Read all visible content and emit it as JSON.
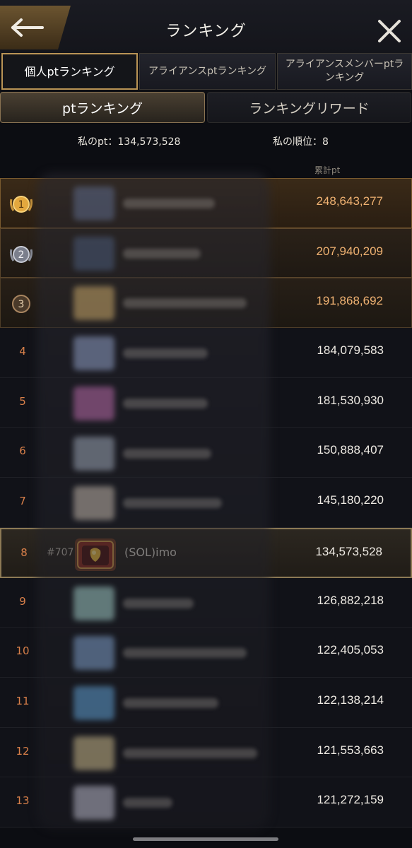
{
  "header": {
    "title": "ランキング"
  },
  "tabs": [
    {
      "label": "個人ptランキング",
      "active": true
    },
    {
      "label": "アライアンスptランキング",
      "active": false
    },
    {
      "label": "アライアンスメンバーptランキング",
      "active": false
    }
  ],
  "subtabs": [
    {
      "label": "ptランキング",
      "active": true
    },
    {
      "label": "ランキングリワード",
      "active": false
    }
  ],
  "my_stats": {
    "pt_label": "私のpt：134,573,528",
    "rank_label": "私の順位：8"
  },
  "columns": {
    "pt": "累計pt"
  },
  "rows": [
    {
      "rank": "1",
      "pts": "248,643,277"
    },
    {
      "rank": "2",
      "pts": "207,940,209"
    },
    {
      "rank": "3",
      "pts": "191,868,692"
    },
    {
      "rank": "4",
      "pts": "184,079,583"
    },
    {
      "rank": "5",
      "pts": "181,530,930"
    },
    {
      "rank": "6",
      "pts": "150,888,407"
    },
    {
      "rank": "7",
      "pts": "145,180,220"
    },
    {
      "rank": "8",
      "tag": "#707",
      "name": "(SOL)imo",
      "pts": "134,573,528"
    },
    {
      "rank": "9",
      "pts": "126,882,218"
    },
    {
      "rank": "10",
      "pts": "122,405,053"
    },
    {
      "rank": "11",
      "pts": "122,138,214"
    },
    {
      "rank": "12",
      "pts": "121,553,663"
    },
    {
      "rank": "13",
      "pts": "121,272,159"
    }
  ],
  "colors": {
    "accent_gold": "#b99455",
    "rank_orange": "#d9804a",
    "top_pts": "#f0b272"
  }
}
